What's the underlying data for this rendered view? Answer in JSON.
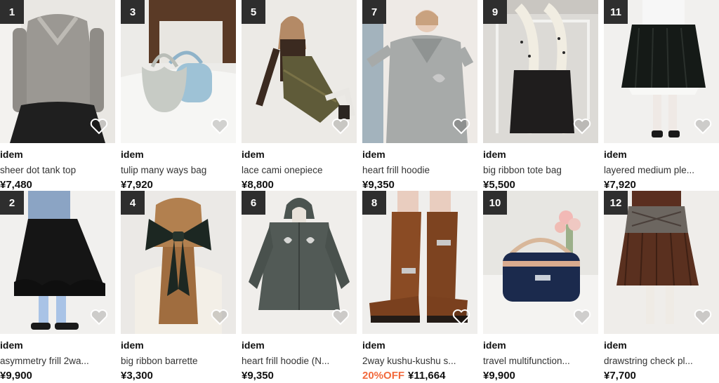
{
  "colors": {
    "rank_badge": "#2e2e2e",
    "sale_text": "#f26a3d",
    "heart_outline": "#ffffff"
  },
  "icons": {
    "favorite": "heart-icon"
  },
  "products": [
    {
      "rank": "1",
      "brand": "idem",
      "name": "sheer dot tank top",
      "price": "¥7,480"
    },
    {
      "rank": "3",
      "brand": "idem",
      "name": "tulip many ways bag",
      "price": "¥7,920"
    },
    {
      "rank": "5",
      "brand": "idem",
      "name": "lace cami onepiece",
      "price": "¥8,800"
    },
    {
      "rank": "7",
      "brand": "idem",
      "name": "heart frill hoodie",
      "price": "¥9,350"
    },
    {
      "rank": "9",
      "brand": "idem",
      "name": "big ribbon tote bag",
      "price": "¥5,500"
    },
    {
      "rank": "11",
      "brand": "idem",
      "name": "layered medium ple...",
      "price": "¥7,920"
    },
    {
      "rank": "2",
      "brand": "idem",
      "name": "asymmetry frill 2wa...",
      "price": "¥9,900"
    },
    {
      "rank": "4",
      "brand": "idem",
      "name": "big ribbon barrette",
      "price": "¥3,300"
    },
    {
      "rank": "6",
      "brand": "idem",
      "name": "heart frill hoodie (N...",
      "price": "¥9,350"
    },
    {
      "rank": "8",
      "brand": "idem",
      "name": "2way kushu-kushu s...",
      "price": "¥11,664",
      "sale": "20%OFF"
    },
    {
      "rank": "10",
      "brand": "idem",
      "name": "travel multifunction...",
      "price": "¥9,900"
    },
    {
      "rank": "12",
      "brand": "idem",
      "name": "drawstring check pl...",
      "price": "¥7,700"
    }
  ]
}
